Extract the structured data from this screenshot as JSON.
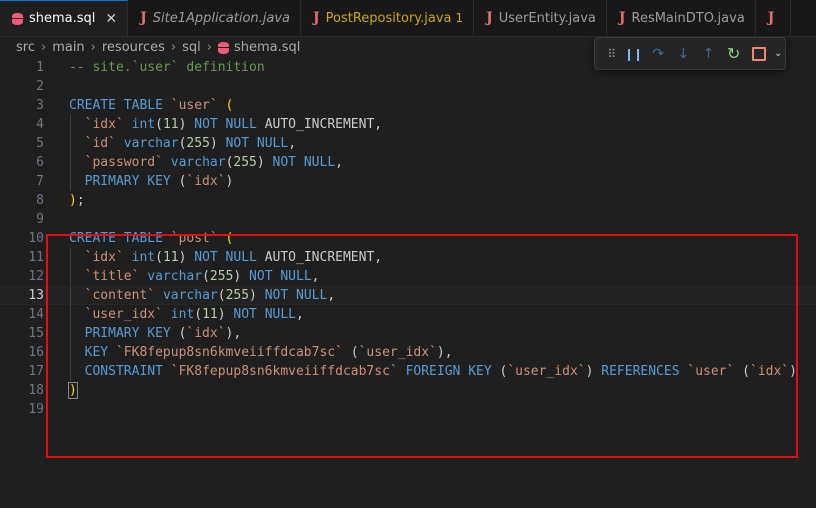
{
  "tabs": [
    {
      "label": "shema.sql",
      "icon": "database-icon",
      "active": true,
      "close": "✕"
    },
    {
      "label": "Site1Application.java",
      "icon": "java-icon",
      "italic": true
    },
    {
      "label": "PostRepository.java",
      "icon": "java-icon",
      "modified": true,
      "badge": "1"
    },
    {
      "label": "UserEntity.java",
      "icon": "java-icon"
    },
    {
      "label": "ResMainDTO.java",
      "icon": "java-icon"
    }
  ],
  "java_glyph": "J",
  "breadcrumb": [
    "src",
    "main",
    "resources",
    "sql",
    "shema.sql"
  ],
  "breadcrumb_sep": "›",
  "debug_toolbar": {
    "grip": "⠿",
    "pause": "❙❙",
    "step_over": "↷",
    "step_into": "↓",
    "step_out": "↑",
    "restart": "↻",
    "more": "⌄"
  },
  "line_numbers": [
    "1",
    "2",
    "3",
    "4",
    "5",
    "6",
    "7",
    "8",
    "9",
    "10",
    "11",
    "12",
    "13",
    "14",
    "15",
    "16",
    "17",
    "18",
    "19"
  ],
  "current_line": "13",
  "code_tokens": [
    [
      {
        "c": "cm",
        "t": "-- site.`user` definition"
      }
    ],
    [],
    [
      {
        "c": "kw",
        "t": "CREATE TABLE "
      },
      {
        "c": "str",
        "t": "`user`"
      },
      {
        "c": "pl",
        "t": " "
      },
      {
        "c": "br1",
        "t": "("
      }
    ],
    [
      {
        "c": "pl",
        "t": "  "
      },
      {
        "c": "str",
        "t": "`idx`"
      },
      {
        "c": "pl",
        "t": " "
      },
      {
        "c": "kw",
        "t": "int"
      },
      {
        "c": "pl",
        "t": "("
      },
      {
        "c": "num",
        "t": "11"
      },
      {
        "c": "pl",
        "t": ") "
      },
      {
        "c": "kw",
        "t": "NOT NULL"
      },
      {
        "c": "pl",
        "t": " AUTO_INCREMENT,"
      }
    ],
    [
      {
        "c": "pl",
        "t": "  "
      },
      {
        "c": "str",
        "t": "`id`"
      },
      {
        "c": "pl",
        "t": " "
      },
      {
        "c": "kw",
        "t": "varchar"
      },
      {
        "c": "pl",
        "t": "("
      },
      {
        "c": "num",
        "t": "255"
      },
      {
        "c": "pl",
        "t": ") "
      },
      {
        "c": "kw",
        "t": "NOT NULL"
      },
      {
        "c": "pl",
        "t": ","
      }
    ],
    [
      {
        "c": "pl",
        "t": "  "
      },
      {
        "c": "str",
        "t": "`password`"
      },
      {
        "c": "pl",
        "t": " "
      },
      {
        "c": "kw",
        "t": "varchar"
      },
      {
        "c": "pl",
        "t": "("
      },
      {
        "c": "num",
        "t": "255"
      },
      {
        "c": "pl",
        "t": ") "
      },
      {
        "c": "kw",
        "t": "NOT NULL"
      },
      {
        "c": "pl",
        "t": ","
      }
    ],
    [
      {
        "c": "pl",
        "t": "  "
      },
      {
        "c": "kw",
        "t": "PRIMARY KEY"
      },
      {
        "c": "pl",
        "t": " ("
      },
      {
        "c": "str",
        "t": "`idx`"
      },
      {
        "c": "pl",
        "t": ")"
      }
    ],
    [
      {
        "c": "br1",
        "t": ")"
      },
      {
        "c": "pl",
        "t": ";"
      }
    ],
    [],
    [
      {
        "c": "kw",
        "t": "CREATE TABLE "
      },
      {
        "c": "str",
        "t": "`post`"
      },
      {
        "c": "pl",
        "t": " "
      },
      {
        "c": "br1",
        "t": "("
      }
    ],
    [
      {
        "c": "pl",
        "t": "  "
      },
      {
        "c": "str",
        "t": "`idx`"
      },
      {
        "c": "pl",
        "t": " "
      },
      {
        "c": "kw",
        "t": "int"
      },
      {
        "c": "pl",
        "t": "("
      },
      {
        "c": "num",
        "t": "11"
      },
      {
        "c": "pl",
        "t": ") "
      },
      {
        "c": "kw",
        "t": "NOT NULL"
      },
      {
        "c": "pl",
        "t": " AUTO_INCREMENT,"
      }
    ],
    [
      {
        "c": "pl",
        "t": "  "
      },
      {
        "c": "str",
        "t": "`title`"
      },
      {
        "c": "pl",
        "t": " "
      },
      {
        "c": "kw",
        "t": "varchar"
      },
      {
        "c": "pl",
        "t": "("
      },
      {
        "c": "num",
        "t": "255"
      },
      {
        "c": "pl",
        "t": ") "
      },
      {
        "c": "kw",
        "t": "NOT NULL"
      },
      {
        "c": "pl",
        "t": ","
      }
    ],
    [
      {
        "c": "pl",
        "t": "  "
      },
      {
        "c": "str",
        "t": "`content`"
      },
      {
        "c": "pl",
        "t": " "
      },
      {
        "c": "kw",
        "t": "varchar"
      },
      {
        "c": "pl",
        "t": "("
      },
      {
        "c": "num",
        "t": "255"
      },
      {
        "c": "pl",
        "t": ") "
      },
      {
        "c": "kw",
        "t": "NOT NULL"
      },
      {
        "c": "pl",
        "t": ","
      }
    ],
    [
      {
        "c": "pl",
        "t": "  "
      },
      {
        "c": "str",
        "t": "`user_idx`"
      },
      {
        "c": "pl",
        "t": " "
      },
      {
        "c": "kw",
        "t": "int"
      },
      {
        "c": "pl",
        "t": "("
      },
      {
        "c": "num",
        "t": "11"
      },
      {
        "c": "pl",
        "t": ") "
      },
      {
        "c": "kw",
        "t": "NOT NULL"
      },
      {
        "c": "pl",
        "t": ","
      }
    ],
    [
      {
        "c": "pl",
        "t": "  "
      },
      {
        "c": "kw",
        "t": "PRIMARY KEY"
      },
      {
        "c": "pl",
        "t": " ("
      },
      {
        "c": "str",
        "t": "`idx`"
      },
      {
        "c": "pl",
        "t": "),"
      }
    ],
    [
      {
        "c": "pl",
        "t": "  "
      },
      {
        "c": "kw",
        "t": "KEY"
      },
      {
        "c": "pl",
        "t": " "
      },
      {
        "c": "str",
        "t": "`FK8fepup8sn6kmveiiffdcab7sc`"
      },
      {
        "c": "pl",
        "t": " ("
      },
      {
        "c": "str",
        "t": "`user_idx`"
      },
      {
        "c": "pl",
        "t": "),"
      }
    ],
    [
      {
        "c": "pl",
        "t": "  "
      },
      {
        "c": "kw",
        "t": "CONSTRAINT"
      },
      {
        "c": "pl",
        "t": " "
      },
      {
        "c": "str",
        "t": "`FK8fepup8sn6kmveiiffdcab7sc`"
      },
      {
        "c": "pl",
        "t": " "
      },
      {
        "c": "kw",
        "t": "FOREIGN KEY"
      },
      {
        "c": "pl",
        "t": " ("
      },
      {
        "c": "str",
        "t": "`user_idx`"
      },
      {
        "c": "pl",
        "t": ") "
      },
      {
        "c": "kw",
        "t": "REFERENCES"
      },
      {
        "c": "pl",
        "t": " "
      },
      {
        "c": "str",
        "t": "`user`"
      },
      {
        "c": "pl",
        "t": " ("
      },
      {
        "c": "str",
        "t": "`idx`"
      },
      {
        "c": "pl",
        "t": ")"
      }
    ],
    [
      {
        "c": "br1 br-match",
        "t": ")"
      }
    ],
    []
  ],
  "colors": {
    "keyword": "#569cd6",
    "string": "#ce9178",
    "number": "#b5cea8",
    "comment": "#6a9955",
    "highlight_box": "#e01010",
    "editor_bg": "#1f1f1f"
  }
}
